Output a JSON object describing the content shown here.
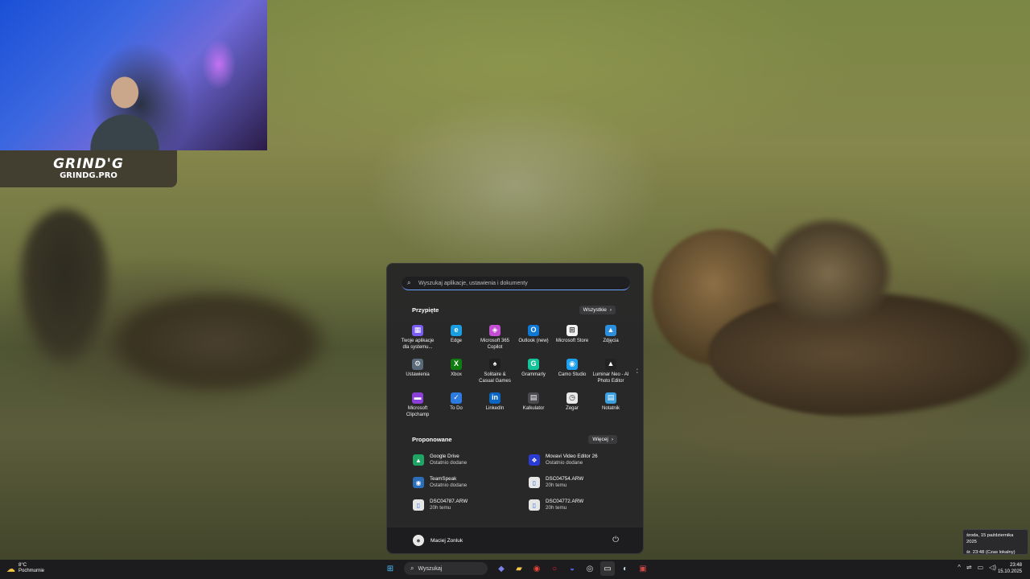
{
  "overlay": {
    "logo_main": "GRIND'G",
    "logo_sub": "GRINDG.PRO"
  },
  "start_menu": {
    "search_placeholder": "Wyszukaj aplikacje, ustawienia i dokumenty",
    "pinned_title": "Przypięte",
    "all_label": "Wszystkie",
    "pinned": [
      {
        "label": "Twoje aplikacje dla systemu...",
        "icon": "phone-link-icon",
        "color": "#7a5cf0"
      },
      {
        "label": "Edge",
        "icon": "edge-icon",
        "color": "#1b9de2"
      },
      {
        "label": "Microsoft 365 Copilot",
        "icon": "copilot-icon",
        "color": "#c24fd1"
      },
      {
        "label": "Outlook (new)",
        "icon": "outlook-icon",
        "color": "#0f78d4"
      },
      {
        "label": "Microsoft Store",
        "icon": "store-icon",
        "color": "#f3f3f3"
      },
      {
        "label": "Zdjęcia",
        "icon": "photos-icon",
        "color": "#2d8fdc"
      },
      {
        "label": "Ustawienia",
        "icon": "settings-icon",
        "color": "#5a6a7a"
      },
      {
        "label": "Xbox",
        "icon": "xbox-icon",
        "color": "#107c10"
      },
      {
        "label": "Solitaire & Casual Games",
        "icon": "solitaire-icon",
        "color": "#1f1f1f"
      },
      {
        "label": "Grammarly",
        "icon": "grammarly-icon",
        "color": "#15c39a"
      },
      {
        "label": "Camo Studio",
        "icon": "camo-icon",
        "color": "#1ea0f0"
      },
      {
        "label": "Luminar Neo - AI Photo Editor",
        "icon": "luminar-icon",
        "color": "#222"
      },
      {
        "label": "Microsoft Clipchamp",
        "icon": "clipchamp-icon",
        "color": "#8b3fd6"
      },
      {
        "label": "To Do",
        "icon": "todo-icon",
        "color": "#2d7be0"
      },
      {
        "label": "LinkedIn",
        "icon": "linkedin-icon",
        "color": "#0a66c2"
      },
      {
        "label": "Kalkulator",
        "icon": "calculator-icon",
        "color": "#4a4a4f"
      },
      {
        "label": "Zegar",
        "icon": "clock-icon",
        "color": "#e8e8e8"
      },
      {
        "label": "Notatnik",
        "icon": "notepad-icon",
        "color": "#3aa0e0"
      }
    ],
    "recommended_title": "Proponowane",
    "more_label": "Więcej",
    "recommended": [
      {
        "name": "Google Drive",
        "sub": "Ostatnio dodane",
        "icon": "google-drive-icon",
        "color": "#1fa463"
      },
      {
        "name": "Movavi Video Editor 26",
        "sub": "Ostatnio dodane",
        "icon": "movavi-icon",
        "color": "#2a3bd6"
      },
      {
        "name": "TeamSpeak",
        "sub": "Ostatnio dodane",
        "icon": "teamspeak-icon",
        "color": "#2a6fb8"
      },
      {
        "name": "DSC04754.ARW",
        "sub": "20h temu",
        "icon": "file-icon",
        "color": "#e6e6e6"
      },
      {
        "name": "DSC04787.ARW",
        "sub": "20h temu",
        "icon": "file-icon",
        "color": "#e6e6e6"
      },
      {
        "name": "DSC04772.ARW",
        "sub": "20h temu",
        "icon": "file-icon",
        "color": "#e6e6e6"
      }
    ],
    "user_name": "Maciej Zonluk"
  },
  "tooltip": {
    "line1": "środa, 15 października 2025",
    "line2": "śr. 23:48 (Czas lokalny)"
  },
  "taskbar": {
    "weather_temp": "8°C",
    "weather_desc": "Pochmurnie",
    "search_label": "Wyszukaj",
    "time": "23:48",
    "date": "15.10.2025"
  }
}
